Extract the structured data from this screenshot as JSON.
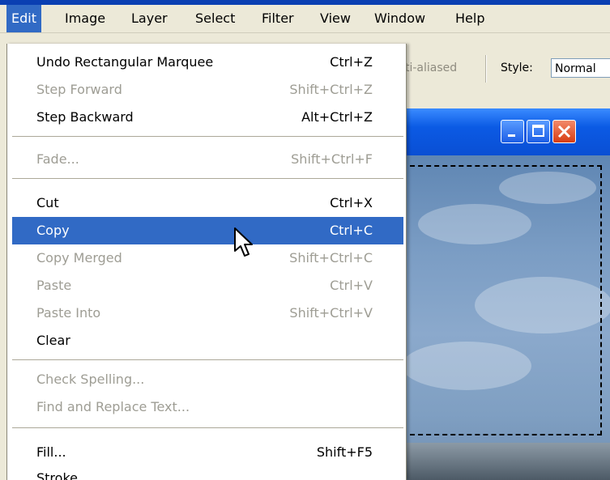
{
  "menubar": {
    "items": [
      {
        "label": "Edit"
      },
      {
        "label": "Image"
      },
      {
        "label": "Layer"
      },
      {
        "label": "Select"
      },
      {
        "label": "Filter"
      },
      {
        "label": "View"
      },
      {
        "label": "Window"
      },
      {
        "label": "Help"
      }
    ]
  },
  "options_bar": {
    "antialias_label": "ti-aliased",
    "style_label": "Style:",
    "style_value": "Normal"
  },
  "edit_menu": {
    "items": [
      {
        "label": "Undo Rectangular Marquee",
        "shortcut": "Ctrl+Z"
      },
      {
        "label": "Step Forward",
        "shortcut": "Shift+Ctrl+Z"
      },
      {
        "label": "Step Backward",
        "shortcut": "Alt+Ctrl+Z"
      },
      {
        "label": "Fade...",
        "shortcut": "Shift+Ctrl+F"
      },
      {
        "label": "Cut",
        "shortcut": "Ctrl+X"
      },
      {
        "label": "Copy",
        "shortcut": "Ctrl+C"
      },
      {
        "label": "Copy Merged",
        "shortcut": "Shift+Ctrl+C"
      },
      {
        "label": "Paste",
        "shortcut": "Ctrl+V"
      },
      {
        "label": "Paste Into",
        "shortcut": "Shift+Ctrl+V"
      },
      {
        "label": "Clear",
        "shortcut": ""
      },
      {
        "label": "Check Spelling...",
        "shortcut": ""
      },
      {
        "label": "Find and Replace Text...",
        "shortcut": ""
      },
      {
        "label": "Fill...",
        "shortcut": "Shift+F5"
      },
      {
        "label": "Stroke",
        "shortcut": ""
      }
    ]
  },
  "colors": {
    "highlight": "#316ac5",
    "title_bar": "#0a54e3",
    "disabled_text": "#9e9d94"
  },
  "icons": [
    "minimize-icon",
    "maximize-icon",
    "close-icon",
    "arrow-cursor-icon"
  ]
}
